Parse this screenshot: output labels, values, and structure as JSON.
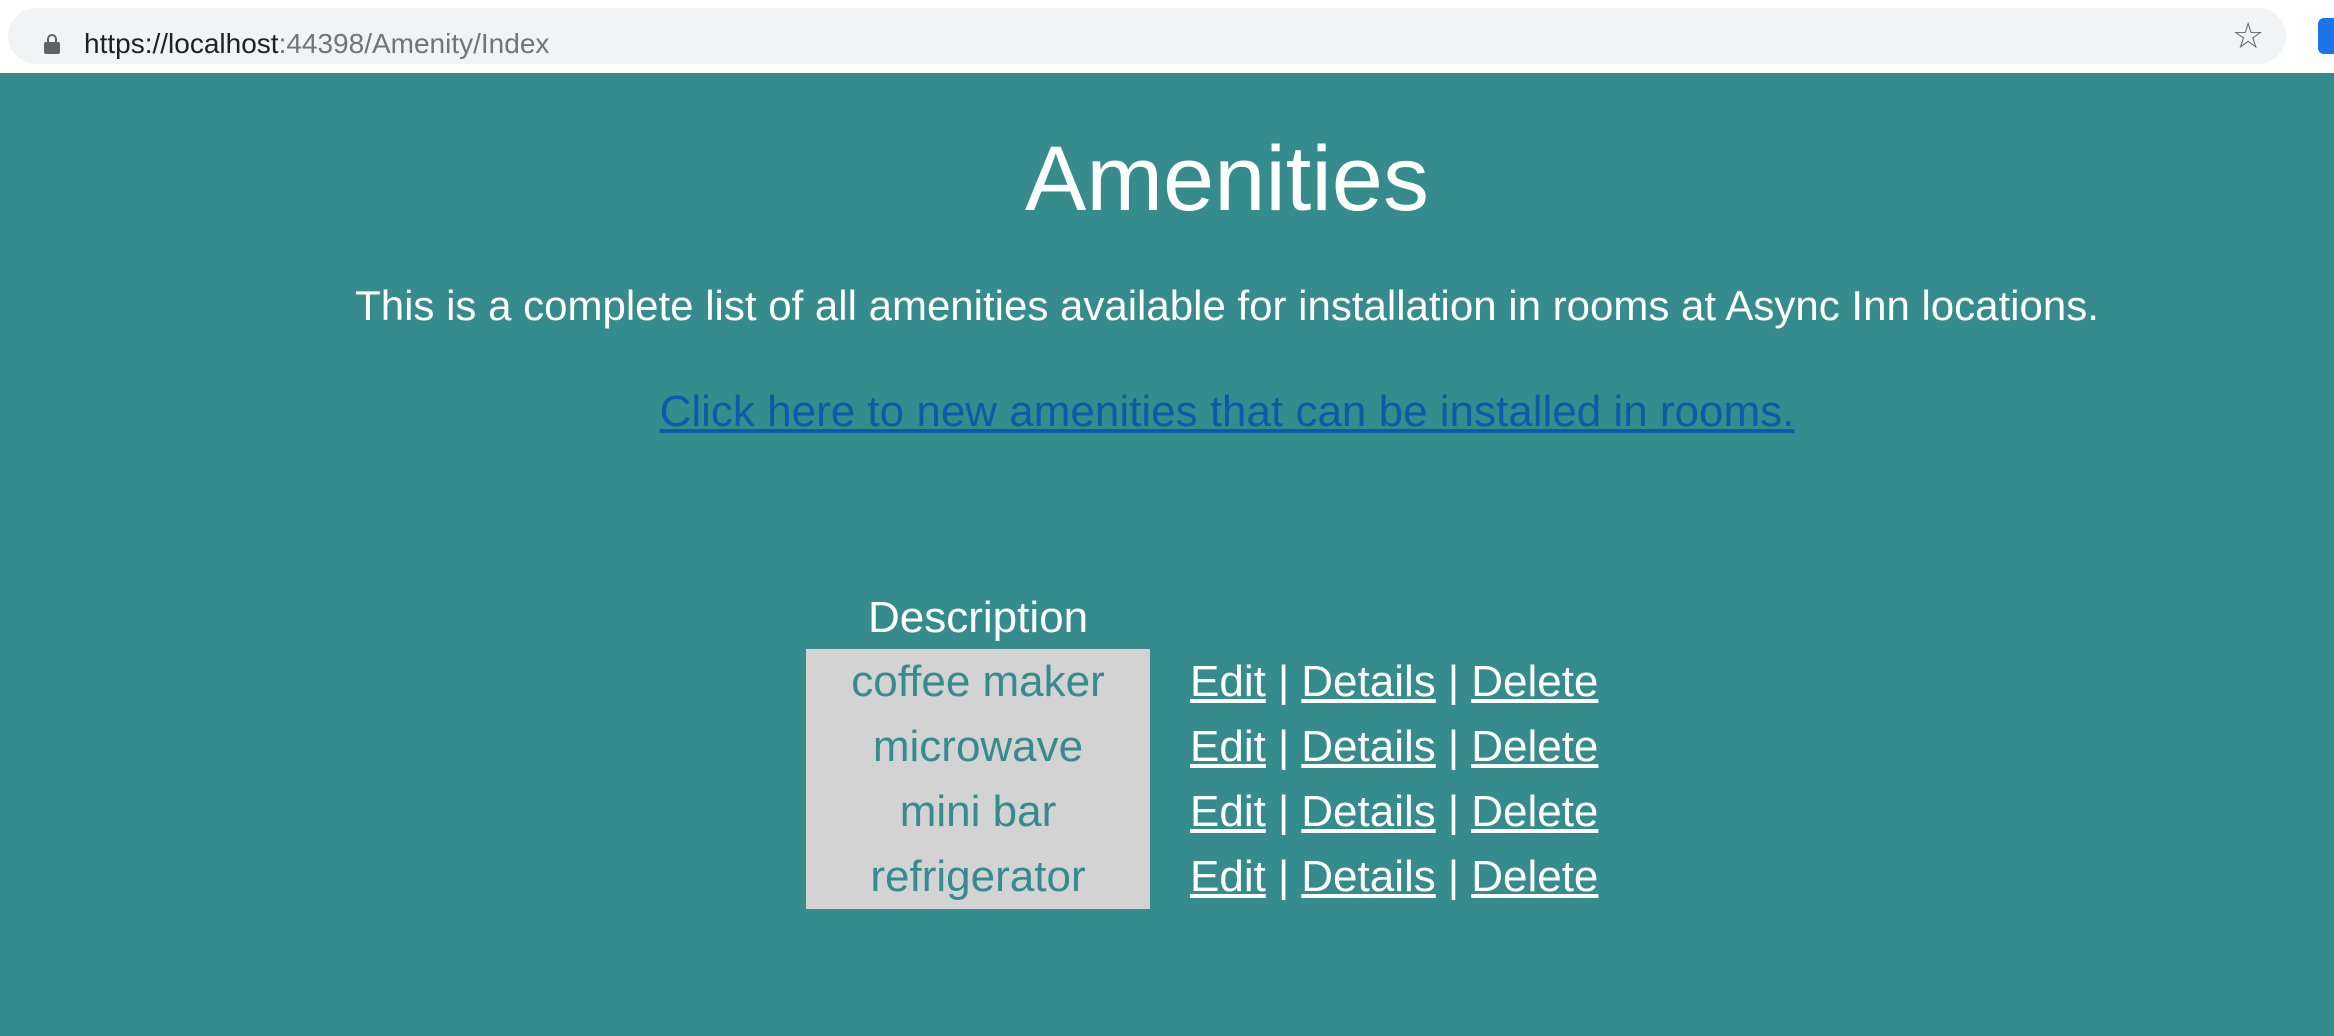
{
  "browser": {
    "url_host": "https://localhost",
    "url_path": ":44398/Amenity/Index"
  },
  "page": {
    "title": "Amenities",
    "intro": "This is a complete list of all amenities available for installation in rooms at Async Inn locations.",
    "create_link": "Click here to new amenities that can be installed in rooms."
  },
  "table": {
    "header": "Description",
    "rows": [
      {
        "description": "coffee maker"
      },
      {
        "description": "microwave"
      },
      {
        "description": "mini bar"
      },
      {
        "description": "refrigerator"
      }
    ],
    "actions": {
      "edit": "Edit",
      "details": "Details",
      "delete": "Delete",
      "separator": "|"
    }
  },
  "icons": {
    "lock": "lock-icon",
    "star": "star-icon",
    "extension": "extension-icon"
  },
  "colors": {
    "background": "#368b8c",
    "cell_background": "#d3d3d3",
    "link": "#0f5aa8"
  }
}
